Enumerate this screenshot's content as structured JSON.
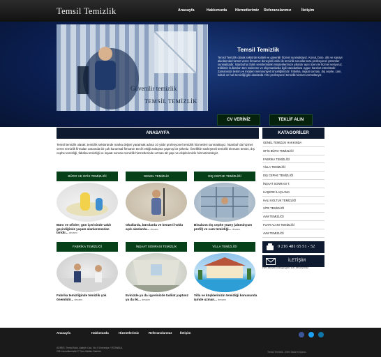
{
  "header": {
    "logo": "Temsil Temizlik",
    "nav": [
      "Anasayfa",
      "Hakkımızda",
      "Hizmetlerimiz",
      "Referanslarımız",
      "İletişim"
    ]
  },
  "hero": {
    "slide_text": "Güvenilir temizlik",
    "slide_brand": "TEMSİL TEMİZLİK",
    "title": "Temsil Temizlik",
    "body": "Temsil Temizlik olarak sektörde kaliteli ve güvenilir hizmet sunmaktayız. Konut, büro, ofis ve sanayi alanlarında hizmet veren firmamız deneyimli ekibi ile temizlik sorunlarınıza profesyonel çözümler sunmaktadır. İstanbul'un farklı semtlerindeki müşterilerimize yıllardır aynı özen ile hizmet veriyoruz. Ekibimiz kullanılan tüm malzeme ve ekipmanlarda ilgili standartlara uygun hareket etmektedir. Zamanında teslim ve müşteri memnuniyeti önceliğimizdir. Fabrika, inşaat sonrası, dış cephe, cam, koltuk ve halı temizliği gibi alanlarda 7/24 profesyonel temizlik hizmeti vermekteyiz.",
    "btn_cv": "CV VERİNİZ",
    "btn_teklif": "TEKLİF ALIN"
  },
  "main": {
    "heading": "ANASAYFA",
    "intro": "Temsil temizlik olarak; temizlik sektöründe marka değeri yaratmak adına 10 yıldır profesyonel temizlik hizmetleri sunmaktayız. İstanbul' da hizmet veren temizlik firmaları arasında bir çok kurumsal firmanın tercih ettiği anlaşma yapmış bir şirketiz. Özellikle sözleşmeli temizlik elemanı temini, dış cephe temizliği, fabrika temizliği ve inşaat sonrası temizlik hizmetlerinde uzman alt yapı ve ekiplerimizle hizmetinizdeyiz.",
    "more": "devamı",
    "cards": [
      {
        "label": "BÜRO VE OFİS TEMİZLİĞİ",
        "text": "Büro ve ofisler; gün içerisinde vakit geçirdiğimiz yaşam alanlarımızdan biridir..."
      },
      {
        "label": "GENEL TEMİZLİK",
        "text": "Okullarda, bürolarda ve benzeri hoklu açık alanlarda..."
      },
      {
        "label": "DIŞ CEPHE TEMİZLİĞİ",
        "text": "Binaların dış cephe yüzey (alüminyum profil) ve cam temizliği..."
      },
      {
        "label": "FABRİKA TEMİZLİĞİ",
        "text": "Fabrika temizliğinde temizlik çok önemlidir..."
      },
      {
        "label": "İNŞAAT SONRASI TEMİZLİK",
        "text": "Evinizde ya da işyerinizde tadilat yaptınız ya da iki..."
      },
      {
        "label": "VİLLA TEMİZLİĞİ",
        "text": "Villa ve köşklerinizin temizliği konusunda işinde uzman..."
      }
    ]
  },
  "sidebar": {
    "heading": "KATAGORİLER",
    "items": [
      "GENEL TEMİZLİK HAKKINDA",
      "OFİS BÜRO TEMİZLİĞİ",
      "FABRİKA TEMİZLİĞİ",
      "VİLLA TEMİZLİĞİ",
      "DIŞ CEPHE TEMİZLİĞİ",
      "İNŞAAT SONRASI T.",
      "HAŞERE İLAÇLAMA",
      "HALI KOLTUK TEMİZLİĞİ",
      "SİTE TEMİZLİĞİ",
      "AVM TEMİZLİĞİ",
      "FUAR ALANI TEMİZLİĞİ",
      "AVM TEMİZLİĞİ"
    ],
    "phone": "0 216 481 65 51 - 52",
    "contact": "İLETİŞİM",
    "note": "Her zaman olduğu gibi sizi bekliyoruz"
  },
  "footer": {
    "nav": [
      "Anasayfa",
      "Hakkımızda",
      "Hizmetlerimiz",
      "Referanslarımız",
      "İletişim"
    ],
    "copy": "ADRES: Temsil Mah. Atatürk Cad. No: 5 Ümraniye / İSTANBUL",
    "copy2": "2014 temsiltemizlik © Tüm Hakları Saklıdır",
    "credit": "Temsil Temizlik - Web Tasarım Ajansı"
  },
  "colors": {
    "navy": "#0d1a30",
    "green": "#064019",
    "dark": "#1a1a1a"
  }
}
